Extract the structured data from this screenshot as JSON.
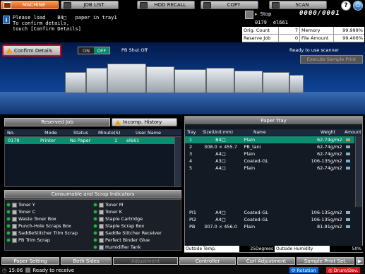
{
  "tabs": [
    {
      "label": "MACHINE",
      "active": true
    },
    {
      "label": "JOB LIST",
      "active": false
    },
    {
      "label": "HDD RECALL",
      "active": false
    },
    {
      "label": "COPY",
      "active": false
    },
    {
      "label": "SCAN",
      "active": false
    }
  ],
  "help_label": "?",
  "message": {
    "icon": "i",
    "line1_prefix": "Please load",
    "line1_size": "B4□",
    "line1_suffix": "paper in tray1",
    "line2": "To confirm details,",
    "line3": "touch [Confirm Details]"
  },
  "status": {
    "state": "Stop",
    "counter": "0000/0001",
    "job_number": "0179",
    "user": "el661"
  },
  "info": {
    "orig_count_label": "Orig. Count",
    "orig_count": "7",
    "memory_label": "Memory",
    "memory": "99.999%",
    "reserve_label": "Reserve Job",
    "reserve": "0",
    "file_amount_label": "File Amount",
    "file_amount": "99.406%"
  },
  "banner": {
    "confirm_label": "Confirm Details",
    "toggle_on": "ON",
    "toggle_off": "OFF",
    "pb_shut": "PB Shut Off",
    "scanner_status": "Ready to use scanner",
    "exec_sample": "Execute Sample Print"
  },
  "reserved": {
    "title": "Reserved Job",
    "incomp_label": "Incomp. History",
    "columns": [
      "No.",
      "Mode",
      "Status",
      "Minute(S)",
      "User Name"
    ],
    "rows": [
      {
        "no": "0179",
        "mode": "Printer",
        "status": "No Paper",
        "minutes": "1",
        "user": "el661"
      }
    ]
  },
  "consumables": {
    "title": "Consumable and Scrap Indicators",
    "left": [
      "Toner Y",
      "Toner C",
      "Waste Toner Box",
      "Punch-Hole Scraps Box",
      "SaddleStitcher Trim Scrap",
      "PB Trim Scrap"
    ],
    "right": [
      "Toner M",
      "Toner K",
      "Staple Cartridge",
      "Staple Scrap Box",
      "Saddle Stitcher Receiver",
      "Perfect Binder Glue",
      "Humidifier Tank"
    ]
  },
  "tray": {
    "title": "Paper Tray",
    "columns": [
      "Tray",
      "Size(Unit:mm)",
      "Name",
      "Weight",
      "Amount"
    ],
    "rows": [
      {
        "tray": "1",
        "size": "B4□",
        "name": "Plain",
        "weight": "62-74g/m2",
        "selected": true,
        "low": true
      },
      {
        "tray": "2",
        "size": "308.0 × 455.7",
        "name": "PB_tani",
        "weight": "62-74g/m2",
        "selected": false,
        "low": false
      },
      {
        "tray": "3",
        "size": "A4□",
        "name": "Plain",
        "weight": "62-74g/m2",
        "selected": false,
        "low": false
      },
      {
        "tray": "4",
        "size": "A3□",
        "name": "Coated-GL",
        "weight": "106-135g/m2",
        "selected": false,
        "low": false
      },
      {
        "tray": "5",
        "size": "A4□",
        "name": "Plain",
        "weight": "62-74g/m2",
        "selected": false,
        "low": false
      }
    ],
    "rows_lower": [
      {
        "tray": "PI1",
        "size": "A4□",
        "name": "Coated-GL",
        "weight": "106-135g/m2"
      },
      {
        "tray": "PI2",
        "size": "A4□",
        "name": "Coated-GL",
        "weight": "106-135g/m2"
      },
      {
        "tray": "PB",
        "size": "307.0 × 456.0",
        "name": "Plain",
        "weight": "81-91g/m2"
      }
    ],
    "outside_temp_label": "Outside Temp.",
    "outside_temp": "25Degrees",
    "outside_hum_label": "Outside Humidity",
    "outside_hum": "50%"
  },
  "bottom": {
    "buttons": [
      "Paper Setting",
      "Both Sides",
      "Adjustment",
      "Controller",
      "Curl Adjustment",
      "Sample Print Set."
    ],
    "time": "15:06",
    "status": "Ready to receive",
    "rotation": "Rotation",
    "drum": "Drum/Dev."
  }
}
